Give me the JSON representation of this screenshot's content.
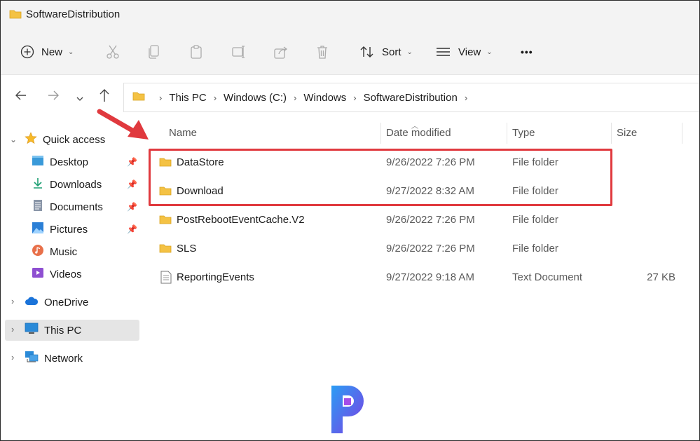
{
  "window": {
    "title": "SoftwareDistribution"
  },
  "toolbar": {
    "new_label": "New",
    "sort_label": "Sort",
    "view_label": "View",
    "more_label": "•••"
  },
  "address": {
    "crumbs": [
      "This PC",
      "Windows (C:)",
      "Windows",
      "SoftwareDistribution"
    ]
  },
  "sidebar": {
    "quick_access": "Quick access",
    "items": [
      {
        "label": "Desktop",
        "icon": "desktop-icon",
        "pinned": true
      },
      {
        "label": "Downloads",
        "icon": "download-icon",
        "pinned": true
      },
      {
        "label": "Documents",
        "icon": "documents-icon",
        "pinned": true
      },
      {
        "label": "Pictures",
        "icon": "pictures-icon",
        "pinned": true
      },
      {
        "label": "Music",
        "icon": "music-icon",
        "pinned": false
      },
      {
        "label": "Videos",
        "icon": "videos-icon",
        "pinned": false
      }
    ],
    "onedrive": "OneDrive",
    "this_pc": "This PC",
    "network": "Network"
  },
  "columns": {
    "name": "Name",
    "date": "Date modified",
    "type": "Type",
    "size": "Size"
  },
  "files": [
    {
      "name": "DataStore",
      "date": "9/26/2022 7:26 PM",
      "type": "File folder",
      "size": "",
      "icon": "folder-icon"
    },
    {
      "name": "Download",
      "date": "9/27/2022 8:32 AM",
      "type": "File folder",
      "size": "",
      "icon": "folder-icon"
    },
    {
      "name": "PostRebootEventCache.V2",
      "date": "9/26/2022 7:26 PM",
      "type": "File folder",
      "size": "",
      "icon": "folder-icon"
    },
    {
      "name": "SLS",
      "date": "9/26/2022 7:26 PM",
      "type": "File folder",
      "size": "",
      "icon": "folder-icon"
    },
    {
      "name": "ReportingEvents",
      "date": "9/27/2022 9:18 AM",
      "type": "Text Document",
      "size": "27 KB",
      "icon": "text-document-icon"
    }
  ],
  "colors": {
    "highlight": "#e0393e",
    "folder": "#f4c244",
    "selection": "#e5e5e5"
  }
}
